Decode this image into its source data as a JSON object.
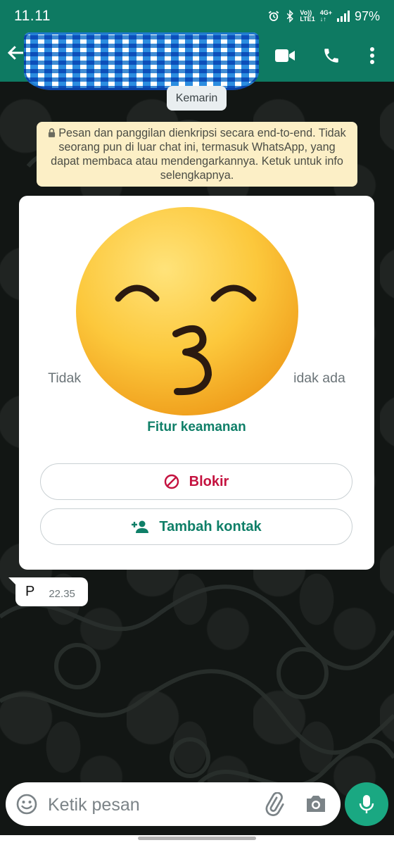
{
  "status_bar": {
    "time": "11.11",
    "volte_top": "Vo))",
    "volte_bottom": "LTE1",
    "network_top": "4G+",
    "network_bottom": "↓↑",
    "battery": "97%"
  },
  "header": {
    "contact_name": "",
    "icons": [
      "back-arrow-icon",
      "video-call-icon",
      "phone-icon",
      "more-vert-icon"
    ]
  },
  "chat": {
    "date_chip": "Kemarin",
    "encryption_notice": "Pesan dan panggilan dienkripsi secara end-to-end. Tidak seorang pun di luar chat ini, termasuk WhatsApp, yang dapat membaca atau mendengarkannya. Ketuk untuk info selengkapnya.",
    "safety_card": {
      "desc_left": "Tidak",
      "desc_right": "idak ada",
      "security_link": "Fitur keamanan",
      "block_label": "Blokir",
      "add_contact_label": "Tambah kontak"
    },
    "messages": [
      {
        "text": "P",
        "time": "22.35"
      }
    ]
  },
  "input": {
    "placeholder": "Ketik pesan"
  },
  "colors": {
    "header": "#0e7a62",
    "accent": "#0f7f68",
    "block": "#c4123f",
    "mic": "#1aa882",
    "notice": "#fcefc6"
  }
}
